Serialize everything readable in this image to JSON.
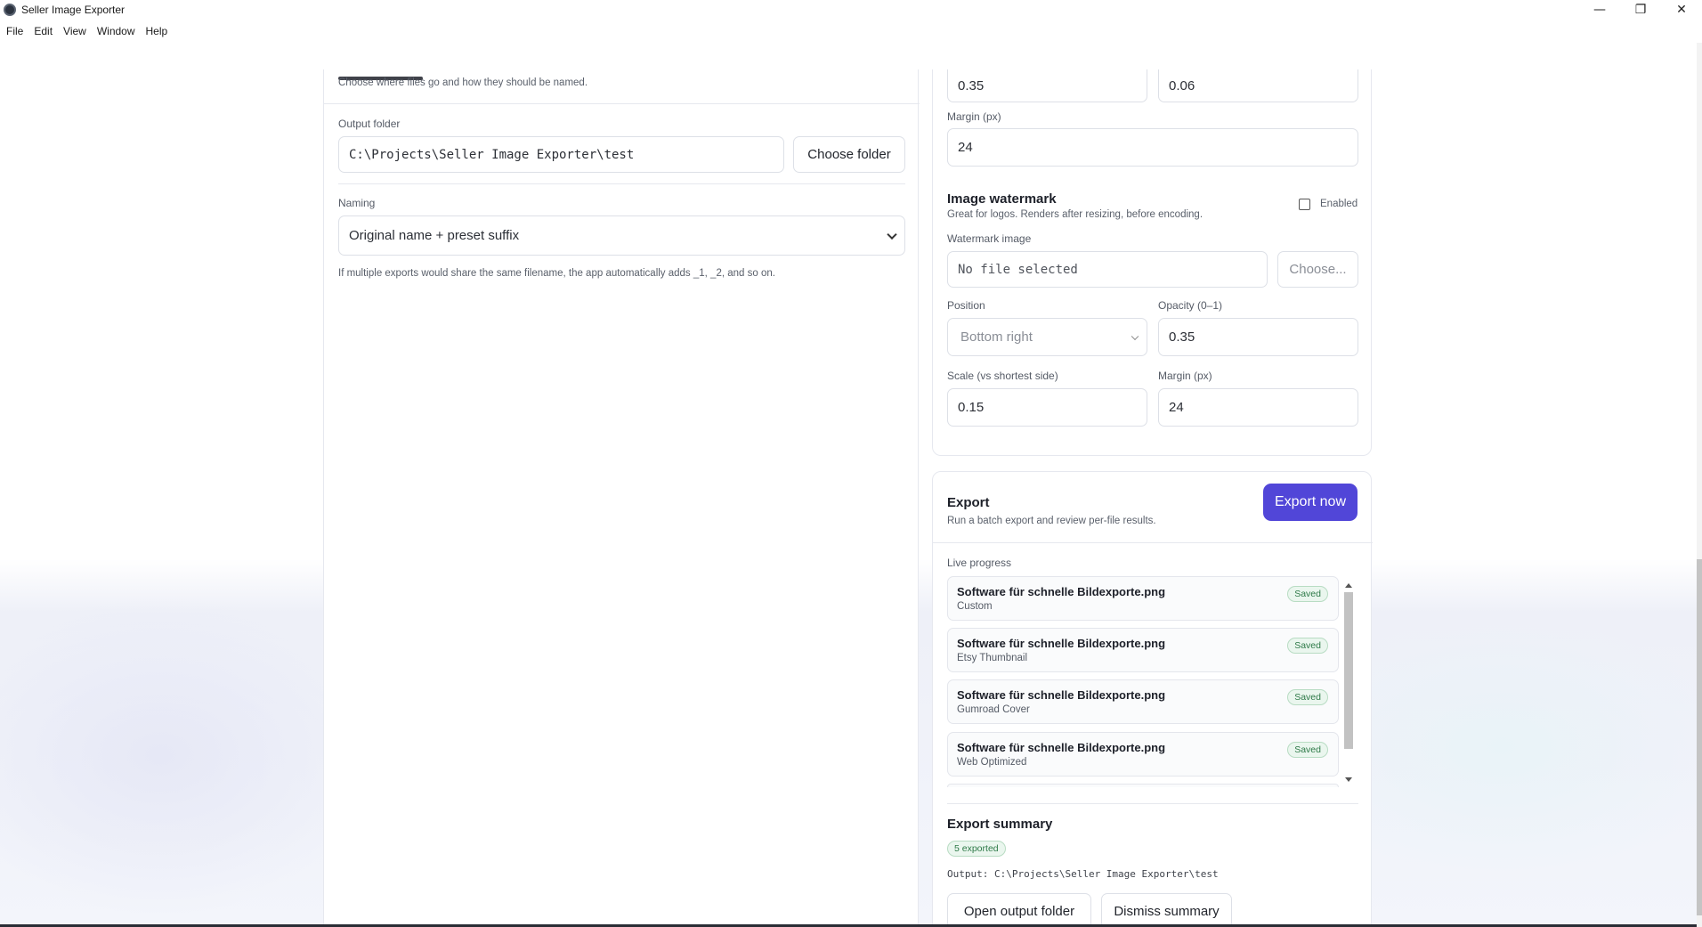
{
  "window": {
    "title": "Seller Image Exporter",
    "controls": {
      "minimize": "—",
      "maximize": "❐",
      "close": "✕"
    }
  },
  "menu": [
    "File",
    "Edit",
    "View",
    "Window",
    "Help"
  ],
  "output_section": {
    "subtitle": "Choose where files go and how they should be named.",
    "output_folder_label": "Output folder",
    "output_folder_value": "C:\\Projects\\Seller Image Exporter\\test",
    "choose_folder_label": "Choose folder",
    "naming_label": "Naming",
    "naming_value": "Original name + preset suffix",
    "naming_hint": "If multiple exports would share the same filename, the app automatically adds _1, _2, and so on."
  },
  "text_watermark": {
    "field_a_value": "0.35",
    "field_b_value": "0.06",
    "margin_label": "Margin (px)",
    "margin_value": "24"
  },
  "image_watermark": {
    "title": "Image watermark",
    "subtitle": "Great for logos. Renders after resizing, before encoding.",
    "enabled_label": "Enabled",
    "enabled": false,
    "image_label": "Watermark image",
    "image_value": "No file selected",
    "choose_label": "Choose...",
    "position_label": "Position",
    "position_value": "Bottom right",
    "opacity_label": "Opacity (0–1)",
    "opacity_value": "0.35",
    "scale_label": "Scale (vs shortest side)",
    "scale_value": "0.15",
    "margin_label": "Margin (px)",
    "margin_value": "24"
  },
  "export": {
    "title": "Export",
    "subtitle": "Run a batch export and review per-file results.",
    "export_now_label": "Export now",
    "live_progress_label": "Live progress",
    "items": [
      {
        "file": "Software für schnelle Bildexporte.png",
        "preset": "Custom",
        "status": "Saved"
      },
      {
        "file": "Software für schnelle Bildexporte.png",
        "preset": "Etsy Thumbnail",
        "status": "Saved"
      },
      {
        "file": "Software für schnelle Bildexporte.png",
        "preset": "Gumroad Cover",
        "status": "Saved"
      },
      {
        "file": "Software für schnelle Bildexporte.png",
        "preset": "Web Optimized",
        "status": "Saved"
      }
    ],
    "summary_title": "Export summary",
    "exported_badge": "5 exported",
    "output_line": "Output: C:\\Projects\\Seller Image Exporter\\test",
    "open_folder_label": "Open output folder",
    "dismiss_label": "Dismiss summary"
  },
  "colors": {
    "primary": "#5146d8",
    "success_bg": "#eaf6ee",
    "success_text": "#2e7a48"
  }
}
